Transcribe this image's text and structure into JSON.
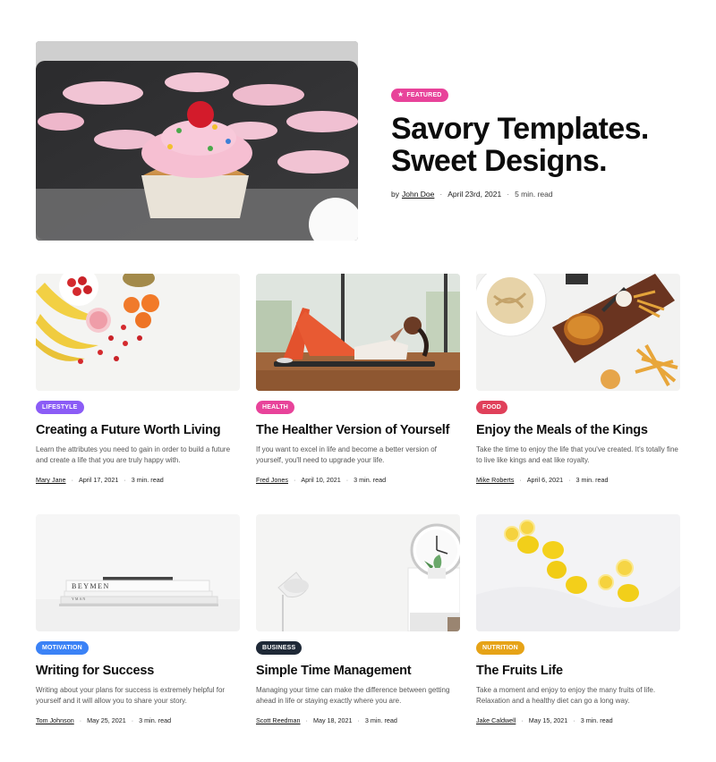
{
  "featured": {
    "badge": "FEATURED",
    "badge_color": "#e8439a",
    "title_line1": "Savory Templates.",
    "title_line2": "Sweet Designs.",
    "by": "by",
    "author": "John Doe",
    "date": "April 23rd, 2021",
    "read": "5 min. read",
    "image": "cupcake-photo"
  },
  "cards": [
    {
      "badge": "LIFESTYLE",
      "badge_color": "#8b5cf6",
      "title": "Creating a Future Worth Living",
      "desc": "Learn the attributes you need to gain in order to build a future and create a life that you are truly happy with.",
      "author": "Mary Jane",
      "date": "April 17, 2021",
      "read": "3 min. read",
      "image": "fruit-photo"
    },
    {
      "badge": "HEALTH",
      "badge_color": "#e8439a",
      "title": "The Healther Version of Yourself",
      "desc": "If you want to excel in life and become a better version of yourself, you'll need to upgrade your life.",
      "author": "Fred Jones",
      "date": "April 10, 2021",
      "read": "3 min. read",
      "image": "workout-photo"
    },
    {
      "badge": "FOOD",
      "badge_color": "#e0405a",
      "title": "Enjoy the Meals of the Kings",
      "desc": "Take the time to enjoy the life that you've created. It's totally fine to live like kings and eat like royalty.",
      "author": "Mike Roberts",
      "date": "April 6, 2021",
      "read": "3 min. read",
      "image": "burger-photo"
    },
    {
      "badge": "MOTIVATION",
      "badge_color": "#3b82f6",
      "title": "Writing for Success",
      "desc": "Writing about your plans for success is extremely helpful for yourself and it will allow you to share your story.",
      "author": "Tom Johnson",
      "date": "May 25, 2021",
      "read": "3 min. read",
      "image": "books-photo",
      "book_text1": "BEYMEN",
      "book_text2": "YMAN"
    },
    {
      "badge": "BUSINESS",
      "badge_color": "#1f2937",
      "title": "Simple Time Management",
      "desc": "Managing your time can make the difference between getting ahead in life or staying exactly where you are.",
      "author": "Scott Reedman",
      "date": "May 18, 2021",
      "read": "3 min. read",
      "image": "clock-photo"
    },
    {
      "badge": "NUTRITION",
      "badge_color": "#e6a317",
      "title": "The Fruits Life",
      "desc": "Take a moment and enjoy to enjoy the many fruits of life. Relaxation and a healthy diet can go a long way.",
      "author": "Jake Caldwell",
      "date": "May 15, 2021",
      "read": "3 min. read",
      "image": "lemons-photo"
    }
  ]
}
